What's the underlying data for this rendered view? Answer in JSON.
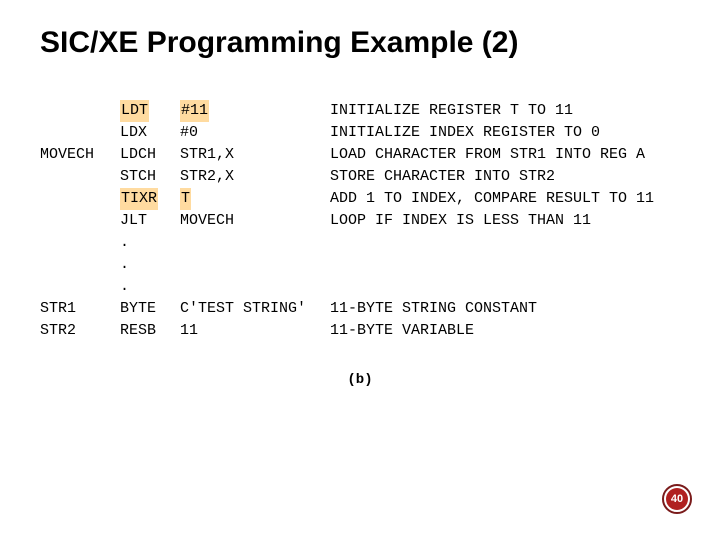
{
  "title": "SIC/XE Programming Example (2)",
  "figure_label": "(b)",
  "page_number": "40",
  "code": {
    "rows": [
      {
        "label": "",
        "op": "LDT",
        "arg": "#11",
        "comment": "INITIALIZE REGISTER T TO 11",
        "hl_op": true,
        "hl_arg": true
      },
      {
        "label": "",
        "op": "LDX",
        "arg": "#0",
        "comment": "INITIALIZE INDEX REGISTER TO 0",
        "hl_op": false,
        "hl_arg": false
      },
      {
        "label": "MOVECH",
        "op": "LDCH",
        "arg": "STR1,X",
        "comment": "LOAD CHARACTER FROM STR1 INTO REG A",
        "hl_op": false,
        "hl_arg": false
      },
      {
        "label": "",
        "op": "STCH",
        "arg": "STR2,X",
        "comment": "STORE CHARACTER INTO STR2",
        "hl_op": false,
        "hl_arg": false
      },
      {
        "label": "",
        "op": "TIXR",
        "arg": "T",
        "comment": "ADD 1 TO INDEX, COMPARE RESULT TO 11",
        "hl_op": true,
        "hl_arg": true
      },
      {
        "label": "",
        "op": "JLT",
        "arg": "MOVECH",
        "comment": "LOOP IF INDEX IS LESS THAN 11",
        "hl_op": false,
        "hl_arg": false
      },
      {
        "label": "",
        "op": ".",
        "arg": "",
        "comment": "",
        "hl_op": false,
        "hl_arg": false
      },
      {
        "label": "",
        "op": ".",
        "arg": "",
        "comment": "",
        "hl_op": false,
        "hl_arg": false
      },
      {
        "label": "",
        "op": ".",
        "arg": "",
        "comment": "",
        "hl_op": false,
        "hl_arg": false
      },
      {
        "label": "STR1",
        "op": "BYTE",
        "arg": "C'TEST STRING'",
        "comment": "11-BYTE STRING CONSTANT",
        "hl_op": false,
        "hl_arg": false
      },
      {
        "label": "STR2",
        "op": "RESB",
        "arg": "11",
        "comment": "11-BYTE VARIABLE",
        "hl_op": false,
        "hl_arg": false
      }
    ]
  }
}
